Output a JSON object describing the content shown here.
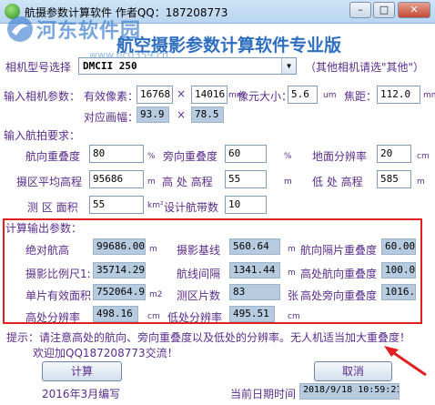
{
  "window": {
    "title": "航摄参数计算软件 作者QQ：187208773",
    "min": "–",
    "max": "□",
    "close": "✕"
  },
  "watermark": {
    "text": "河东软件园",
    "url": "www.pc0359.cn"
  },
  "app_title": "航空摄影参数计算软件专业版",
  "camera": {
    "label": "相机型号选择",
    "selected": "DMCII 250",
    "hint": "（其他相机请选\"其他\"）"
  },
  "input_camera": {
    "section": "输入相机参数：",
    "pixels_label": "有效像素：",
    "pixels_w": "16768",
    "pixels_h": "14016",
    "pixels_unit": "mm",
    "pixel_size_label": "像元大小：",
    "pixel_size": "5.6",
    "pixel_size_unit": "um",
    "focal_label": "焦距：",
    "focal": "112.0",
    "focal_unit": "mm",
    "frame_label": "对应画幅：",
    "frame_w": "93.9",
    "frame_h": "78.5",
    "times": "×"
  },
  "input_flight": {
    "section": "输入航拍要求：",
    "fwd_overlap_label": "航向重叠度",
    "fwd_overlap": "80",
    "side_overlap_label": "旁向重叠度",
    "side_overlap": "60",
    "gsd_label": "地面分辨率",
    "gsd": "20",
    "gsd_unit": "cm",
    "avg_elev_label": "摄区平均高程",
    "avg_elev": "95686",
    "avg_elev_unit": "m",
    "high_elev_label": "高 处 高程",
    "high_elev": "55",
    "high_elev_unit": "m",
    "low_elev_label": "低 处 高程",
    "low_elev": "585",
    "low_elev_unit": "m",
    "area_label": "测 区 面积",
    "area": "55",
    "area_unit": "km²",
    "strips_label": "设计航带数",
    "strips": "10",
    "pct": "%"
  },
  "output": {
    "section": "计算输出参数：",
    "abs_alt_label": "绝对航高",
    "abs_alt": "99686.00",
    "abs_alt_unit": "m",
    "baseline_label": "摄影基线",
    "baseline": "560.64",
    "baseline_unit": "m",
    "side_low_label": "航向隔片重叠度",
    "side_low": "60.00",
    "scale_label": "摄影比例尺1:",
    "scale": "35714.29",
    "strip_spacing_label": "航线间隔",
    "strip_spacing": "1341.44",
    "strip_spacing_unit": "m",
    "high_fwd_label": "高处航向重叠度",
    "high_fwd": "100.00",
    "photo_area_label": "单片有效面积",
    "photo_area": "752064.92",
    "photo_area_unit": "m2",
    "photo_count_label": "测区片数",
    "photo_count": "83",
    "photo_count_unit": "张",
    "high_side_label": "高处旁向重叠度",
    "high_side": "1016.3",
    "high_gsd_label": "高处分辨率",
    "high_gsd": "498.16",
    "high_gsd_unit": "cm",
    "low_gsd_label": "低处分辨率",
    "low_gsd": "495.51",
    "low_gsd_unit": "cm"
  },
  "tip": {
    "line1": "提示：请注意高处的航向、旁向重叠度以及低处的分辨率。无人机适当加大重叠度！",
    "line2": "欢迎加QQ187208773交流！"
  },
  "buttons": {
    "calc": "计算",
    "cancel": "取消"
  },
  "footer": {
    "author_date": "2016年3月编写",
    "now_label": "当前日期时间",
    "now": "2018/9/18  10:59:21"
  },
  "colors": {
    "accent": "#2f6fc0",
    "label": "#5a2d8c",
    "highlight": "#e02020",
    "readonly": "#b7cbe0"
  }
}
